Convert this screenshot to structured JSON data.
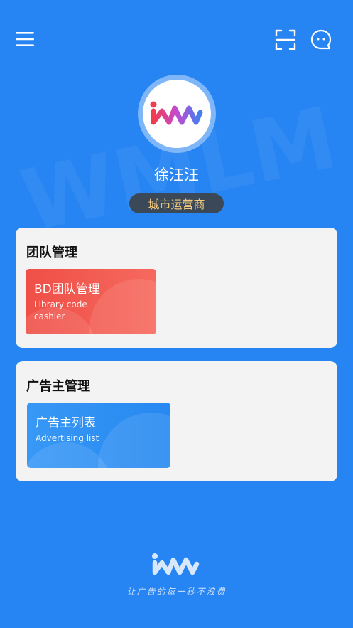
{
  "header": {
    "menu_icon": "menu-icon",
    "scan_icon": "scan-icon",
    "chat_icon": "chat-icon"
  },
  "watermark": {
    "text": "WMLM"
  },
  "profile": {
    "name": "徐汪汪",
    "role": "城市运营商"
  },
  "sections": [
    {
      "title": "团队管理",
      "cards": [
        {
          "title": "BD团队管理",
          "sub_line1": "Library code",
          "sub_line2": "cashier",
          "color": "#f2574e"
        }
      ]
    },
    {
      "title": "广告主管理",
      "cards": [
        {
          "title": "广告主列表",
          "sub_line1": "Advertising list",
          "color": "#2b8df3"
        }
      ]
    }
  ],
  "footer": {
    "slogan": "让广告的每一秒不浪费"
  },
  "colors": {
    "background": "#2684f3",
    "panel": "#f3f3f3",
    "badge_bg": "#3a4858",
    "badge_text": "#f2c87e"
  }
}
